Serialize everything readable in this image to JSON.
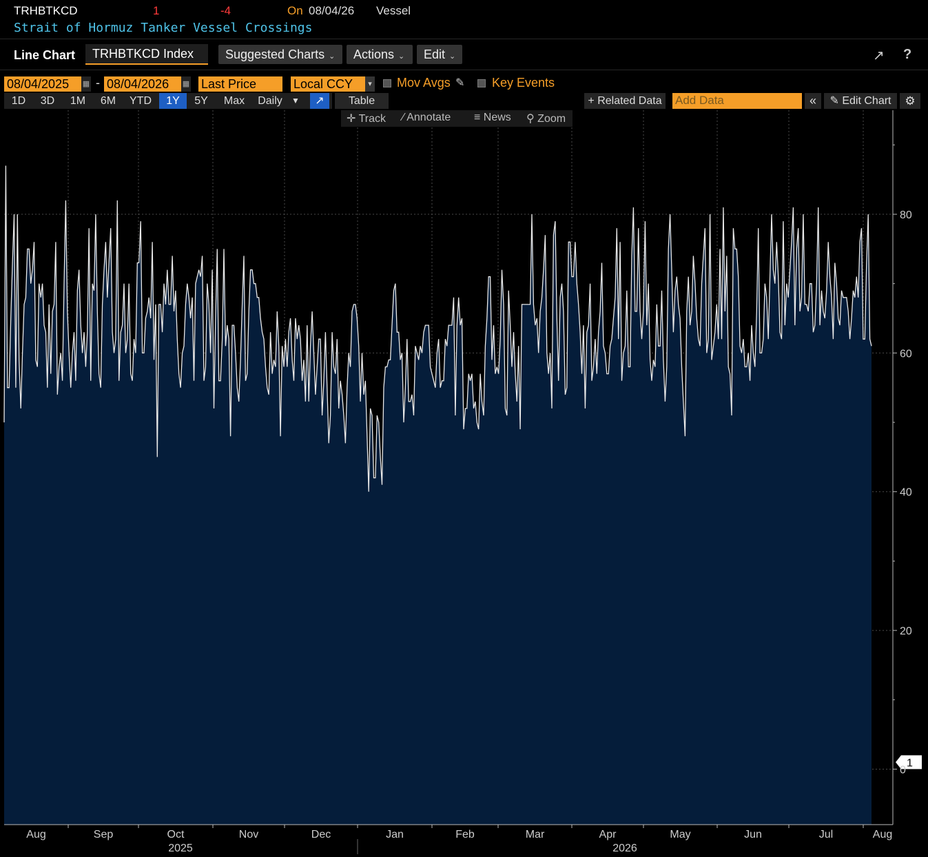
{
  "header": {
    "ticker": "TRHBTKCD",
    "last": "1",
    "change": "-4",
    "on_label": "On",
    "date": "08/04/26",
    "unit": "Vessel",
    "description": "Strait of Hormuz Tanker Vessel Crossings",
    "colors": {
      "ticker": "#ffffff",
      "last": "#ff3b3b",
      "change": "#ff3b3b",
      "on": "#f59e28",
      "description": "#4fc3e8"
    }
  },
  "toolbar": {
    "title": "Line Chart",
    "security": "TRHBTKCD Index",
    "suggested_label": "Suggested Charts",
    "actions_label": "Actions",
    "edit_label": "Edit",
    "icons": [
      "export-icon",
      "help-icon"
    ]
  },
  "options": {
    "start_date": "08/04/2025",
    "date_separator": "-",
    "end_date": "08/04/2026",
    "field": "Last Price",
    "currency": "Local CCY",
    "mov_avgs_label": "Mov Avgs",
    "key_events_label": "Key Events"
  },
  "range_buttons": [
    "1D",
    "3D",
    "1M",
    "6M",
    "YTD",
    "1Y",
    "5Y",
    "Max"
  ],
  "active_range": "1Y",
  "frequency": "Daily",
  "table_label": "Table",
  "related_label": "Related Data",
  "add_data_placeholder": "Add Data",
  "edit_chart_label": "Edit Chart",
  "sub_tools": [
    "Track",
    "Annotate",
    "News",
    "Zoom"
  ],
  "chart_data": {
    "type": "area",
    "series": [
      {
        "name": "",
        "color": "#e8e8e8",
        "fill": "#051d3a"
      }
    ],
    "ylim": [
      -8,
      95
    ],
    "yticks": [
      0,
      20,
      40,
      60,
      80
    ],
    "last_value_label": "1",
    "x_months": [
      "Aug",
      "Sep",
      "Oct",
      "Nov",
      "Dec",
      "Jan",
      "Feb",
      "Mar",
      "Apr",
      "May",
      "Jun",
      "Jul",
      "Aug"
    ],
    "x_years": [
      "2025",
      "2026"
    ],
    "grid": true,
    "x_start": "2025-08-04",
    "y": [
      50,
      87,
      55,
      55,
      65,
      73,
      80,
      55,
      80,
      59,
      52,
      60,
      67,
      68,
      75,
      75,
      70,
      72,
      76,
      59,
      58,
      70,
      68,
      70,
      64,
      63,
      55,
      67,
      57,
      66,
      67,
      76,
      54,
      58,
      60,
      56,
      70,
      82,
      66,
      60,
      55,
      60,
      63,
      56,
      69,
      72,
      64,
      60,
      63,
      58,
      63,
      78,
      56,
      70,
      69,
      80,
      66,
      57,
      55,
      67,
      72,
      76,
      68,
      73,
      78,
      63,
      60,
      62,
      82,
      56,
      63,
      64,
      70,
      60,
      62,
      70,
      57,
      56,
      62,
      60,
      73,
      73,
      79,
      60,
      60,
      65,
      66,
      68,
      65,
      76,
      59,
      67,
      45,
      67,
      67,
      63,
      70,
      67,
      72,
      67,
      67,
      74,
      66,
      69,
      62,
      57,
      55,
      60,
      61,
      67,
      70,
      68,
      65,
      68,
      56,
      70,
      71,
      72,
      71,
      74,
      56,
      58,
      70,
      67,
      60,
      72,
      52,
      65,
      75,
      56,
      56,
      62,
      75,
      61,
      64,
      62,
      48,
      64,
      64,
      60,
      55,
      53,
      59,
      67,
      74,
      56,
      57,
      66,
      72,
      72,
      70,
      70,
      68,
      68,
      65,
      63,
      62,
      58,
      55,
      54,
      63,
      57,
      59,
      58,
      66,
      61,
      48,
      61,
      58,
      62,
      58,
      63,
      65,
      59,
      56,
      65,
      62,
      64,
      62,
      56,
      59,
      53,
      64,
      53,
      61,
      66,
      60,
      54,
      58,
      62,
      62,
      51,
      56,
      63,
      55,
      47,
      51,
      63,
      58,
      57,
      62,
      52,
      56,
      54,
      51,
      47,
      55,
      60,
      58,
      66,
      67,
      67,
      65,
      61,
      53,
      60,
      54,
      56,
      48,
      40,
      52,
      51,
      42,
      42,
      51,
      50,
      45,
      41,
      55,
      58,
      58,
      59,
      59,
      64,
      69,
      70,
      63,
      63,
      59,
      60,
      50,
      55,
      62,
      53,
      53,
      54,
      51,
      61,
      60,
      59,
      61,
      60,
      63,
      64,
      64,
      64,
      58,
      57,
      56,
      55,
      60,
      62,
      55,
      56,
      56,
      62,
      61,
      64,
      64,
      64,
      68,
      51,
      64,
      68,
      64,
      65,
      49,
      52,
      52,
      57,
      56,
      57,
      52,
      53,
      50,
      49,
      57,
      53,
      51,
      61,
      65,
      71,
      71,
      59,
      64,
      57,
      58,
      57,
      62,
      72,
      67,
      52,
      51,
      69,
      64,
      58,
      63,
      57,
      53,
      61,
      49,
      67,
      67,
      67,
      67,
      67,
      67,
      80,
      67,
      64,
      65,
      60,
      66,
      68,
      72,
      77,
      60,
      57,
      60,
      52,
      77,
      79,
      65,
      56,
      68,
      70,
      66,
      54,
      55,
      76,
      76,
      71,
      71,
      76,
      70,
      67,
      63,
      57,
      64,
      52,
      63,
      64,
      70,
      56,
      58,
      62,
      57,
      63,
      66,
      73,
      61,
      60,
      57,
      57,
      61,
      62,
      65,
      68,
      78,
      62,
      76,
      56,
      60,
      61,
      69,
      58,
      58,
      74,
      81,
      66,
      66,
      78,
      66,
      62,
      66,
      79,
      64,
      70,
      59,
      56,
      59,
      58,
      67,
      61,
      61,
      69,
      59,
      53,
      58,
      75,
      80,
      72,
      63,
      69,
      71,
      67,
      65,
      58,
      53,
      48,
      66,
      71,
      64,
      66,
      74,
      70,
      65,
      62,
      61,
      70,
      74,
      78,
      60,
      62,
      80,
      59,
      61,
      63,
      67,
      62,
      75,
      62,
      81,
      66,
      74,
      58,
      57,
      51,
      78,
      75,
      75,
      71,
      61,
      60,
      62,
      58,
      58,
      60,
      56,
      64,
      60,
      58,
      66,
      78,
      60,
      60,
      62,
      70,
      68,
      62,
      71,
      80,
      72,
      70,
      76,
      71,
      63,
      62,
      79,
      64,
      70,
      68,
      72,
      76,
      81,
      64,
      75,
      78,
      66,
      68,
      80,
      67,
      67,
      66,
      70,
      70,
      63,
      64,
      70,
      81,
      64,
      69,
      66,
      65,
      69,
      76,
      71,
      68,
      62,
      73,
      70,
      65,
      64,
      69,
      68,
      68,
      68,
      66,
      62,
      65,
      69,
      68,
      71,
      68,
      76,
      78,
      62,
      62,
      73,
      80,
      62,
      61
    ]
  }
}
